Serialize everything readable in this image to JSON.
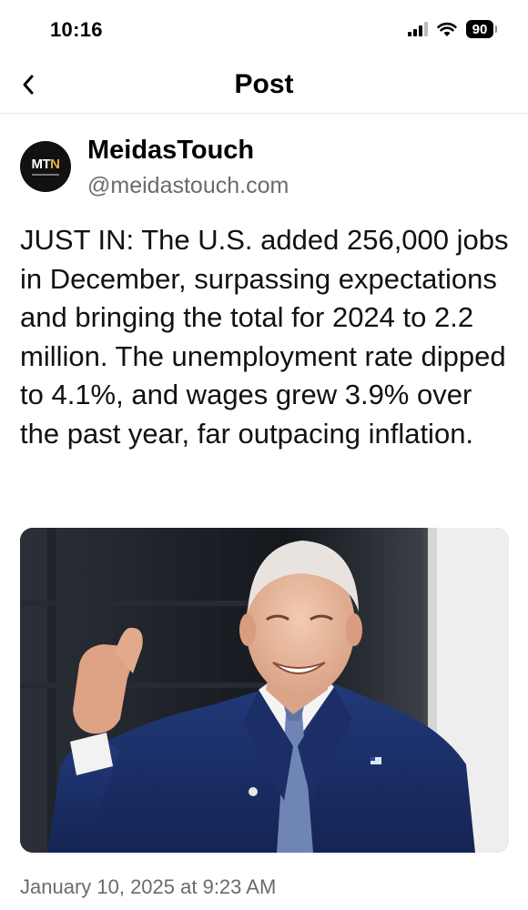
{
  "status_bar": {
    "time": "10:16",
    "battery": "90"
  },
  "nav": {
    "title": "Post"
  },
  "author": {
    "name": "MeidasTouch",
    "handle": "@meidastouch.com",
    "avatar_text_main": "MT",
    "avatar_text_accent": "N"
  },
  "post": {
    "text": "JUST IN: The U.S. added 256,000 jobs in December, surpassing expectations and bringing the total for 2024 to 2.2 million. The unemployment rate dipped to 4.1%, and wages grew 3.9% over the past year, far outpacing inflation.",
    "timestamp": "January 10, 2025 at 9:23 AM"
  },
  "icons": {
    "back": "chevron-left-icon",
    "signal": "cellular-signal-icon",
    "wifi": "wifi-icon",
    "battery": "battery-icon"
  },
  "colors": {
    "text": "#111111",
    "secondary": "#6b6b6b",
    "accent_logo": "#e7b24a"
  }
}
